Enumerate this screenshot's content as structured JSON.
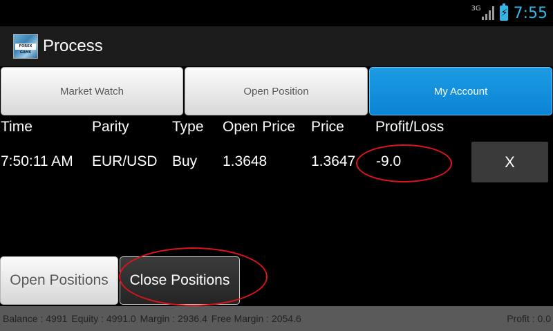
{
  "status_bar": {
    "network": "3G",
    "time": "7:55",
    "icons": [
      "signal-icon",
      "battery-charging-icon"
    ]
  },
  "app": {
    "title": "Process",
    "icon_text": "FOREX GAME"
  },
  "tabs": [
    {
      "label": "Market Watch",
      "active": false
    },
    {
      "label": "Open Position",
      "active": false
    },
    {
      "label": "My Account",
      "active": true
    }
  ],
  "table": {
    "columns": [
      "Time",
      "Parity",
      "Type",
      "Open Price",
      "Price",
      "Profit/Loss"
    ],
    "rows": [
      {
        "time": "7:50:11 AM",
        "parity": "EUR/USD",
        "type": "Buy",
        "open_price": "1.3648",
        "price": "1.3647",
        "profit_loss": "-9.0",
        "close_label": "X"
      }
    ]
  },
  "actions": {
    "open_positions": "Open Positions",
    "close_positions": "Close Positions"
  },
  "footer": {
    "balance": "Balance : 4991",
    "equity": "Equity : 4991.0",
    "margin": "Margin : 2936.4",
    "free_margin": "Free Margin : 2054.6",
    "profit": "Profit : 0.0"
  },
  "colors": {
    "accent": "#33b5e5",
    "active_tab": "#0a84d6",
    "annotation": "#e0131b",
    "footer_bg": "#5a5a5a"
  }
}
